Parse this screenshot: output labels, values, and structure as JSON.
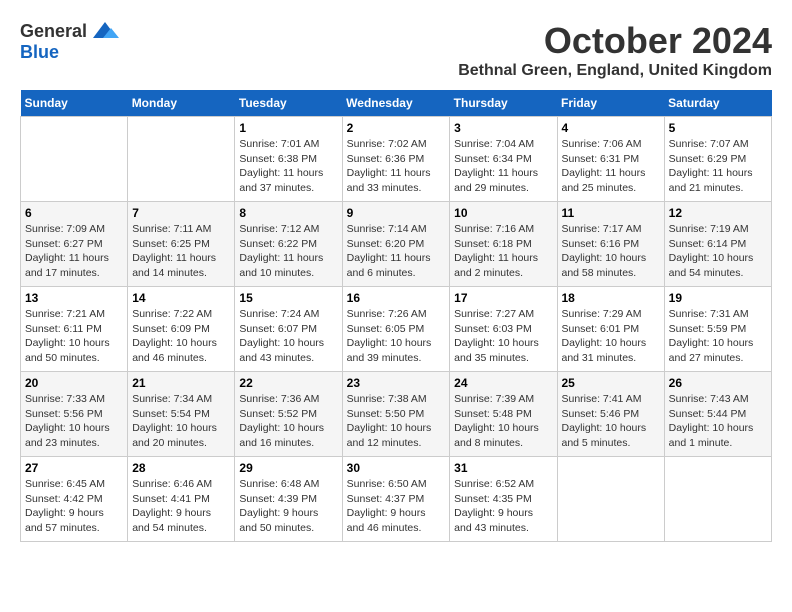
{
  "logo": {
    "general": "General",
    "blue": "Blue"
  },
  "title": {
    "month": "October 2024",
    "location": "Bethnal Green, England, United Kingdom"
  },
  "weekdays": [
    "Sunday",
    "Monday",
    "Tuesday",
    "Wednesday",
    "Thursday",
    "Friday",
    "Saturday"
  ],
  "weeks": [
    [
      {
        "day": "",
        "info": ""
      },
      {
        "day": "",
        "info": ""
      },
      {
        "day": "1",
        "info": "Sunrise: 7:01 AM\nSunset: 6:38 PM\nDaylight: 11 hours and 37 minutes."
      },
      {
        "day": "2",
        "info": "Sunrise: 7:02 AM\nSunset: 6:36 PM\nDaylight: 11 hours and 33 minutes."
      },
      {
        "day": "3",
        "info": "Sunrise: 7:04 AM\nSunset: 6:34 PM\nDaylight: 11 hours and 29 minutes."
      },
      {
        "day": "4",
        "info": "Sunrise: 7:06 AM\nSunset: 6:31 PM\nDaylight: 11 hours and 25 minutes."
      },
      {
        "day": "5",
        "info": "Sunrise: 7:07 AM\nSunset: 6:29 PM\nDaylight: 11 hours and 21 minutes."
      }
    ],
    [
      {
        "day": "6",
        "info": "Sunrise: 7:09 AM\nSunset: 6:27 PM\nDaylight: 11 hours and 17 minutes."
      },
      {
        "day": "7",
        "info": "Sunrise: 7:11 AM\nSunset: 6:25 PM\nDaylight: 11 hours and 14 minutes."
      },
      {
        "day": "8",
        "info": "Sunrise: 7:12 AM\nSunset: 6:22 PM\nDaylight: 11 hours and 10 minutes."
      },
      {
        "day": "9",
        "info": "Sunrise: 7:14 AM\nSunset: 6:20 PM\nDaylight: 11 hours and 6 minutes."
      },
      {
        "day": "10",
        "info": "Sunrise: 7:16 AM\nSunset: 6:18 PM\nDaylight: 11 hours and 2 minutes."
      },
      {
        "day": "11",
        "info": "Sunrise: 7:17 AM\nSunset: 6:16 PM\nDaylight: 10 hours and 58 minutes."
      },
      {
        "day": "12",
        "info": "Sunrise: 7:19 AM\nSunset: 6:14 PM\nDaylight: 10 hours and 54 minutes."
      }
    ],
    [
      {
        "day": "13",
        "info": "Sunrise: 7:21 AM\nSunset: 6:11 PM\nDaylight: 10 hours and 50 minutes."
      },
      {
        "day": "14",
        "info": "Sunrise: 7:22 AM\nSunset: 6:09 PM\nDaylight: 10 hours and 46 minutes."
      },
      {
        "day": "15",
        "info": "Sunrise: 7:24 AM\nSunset: 6:07 PM\nDaylight: 10 hours and 43 minutes."
      },
      {
        "day": "16",
        "info": "Sunrise: 7:26 AM\nSunset: 6:05 PM\nDaylight: 10 hours and 39 minutes."
      },
      {
        "day": "17",
        "info": "Sunrise: 7:27 AM\nSunset: 6:03 PM\nDaylight: 10 hours and 35 minutes."
      },
      {
        "day": "18",
        "info": "Sunrise: 7:29 AM\nSunset: 6:01 PM\nDaylight: 10 hours and 31 minutes."
      },
      {
        "day": "19",
        "info": "Sunrise: 7:31 AM\nSunset: 5:59 PM\nDaylight: 10 hours and 27 minutes."
      }
    ],
    [
      {
        "day": "20",
        "info": "Sunrise: 7:33 AM\nSunset: 5:56 PM\nDaylight: 10 hours and 23 minutes."
      },
      {
        "day": "21",
        "info": "Sunrise: 7:34 AM\nSunset: 5:54 PM\nDaylight: 10 hours and 20 minutes."
      },
      {
        "day": "22",
        "info": "Sunrise: 7:36 AM\nSunset: 5:52 PM\nDaylight: 10 hours and 16 minutes."
      },
      {
        "day": "23",
        "info": "Sunrise: 7:38 AM\nSunset: 5:50 PM\nDaylight: 10 hours and 12 minutes."
      },
      {
        "day": "24",
        "info": "Sunrise: 7:39 AM\nSunset: 5:48 PM\nDaylight: 10 hours and 8 minutes."
      },
      {
        "day": "25",
        "info": "Sunrise: 7:41 AM\nSunset: 5:46 PM\nDaylight: 10 hours and 5 minutes."
      },
      {
        "day": "26",
        "info": "Sunrise: 7:43 AM\nSunset: 5:44 PM\nDaylight: 10 hours and 1 minute."
      }
    ],
    [
      {
        "day": "27",
        "info": "Sunrise: 6:45 AM\nSunset: 4:42 PM\nDaylight: 9 hours and 57 minutes."
      },
      {
        "day": "28",
        "info": "Sunrise: 6:46 AM\nSunset: 4:41 PM\nDaylight: 9 hours and 54 minutes."
      },
      {
        "day": "29",
        "info": "Sunrise: 6:48 AM\nSunset: 4:39 PM\nDaylight: 9 hours and 50 minutes."
      },
      {
        "day": "30",
        "info": "Sunrise: 6:50 AM\nSunset: 4:37 PM\nDaylight: 9 hours and 46 minutes."
      },
      {
        "day": "31",
        "info": "Sunrise: 6:52 AM\nSunset: 4:35 PM\nDaylight: 9 hours and 43 minutes."
      },
      {
        "day": "",
        "info": ""
      },
      {
        "day": "",
        "info": ""
      }
    ]
  ]
}
